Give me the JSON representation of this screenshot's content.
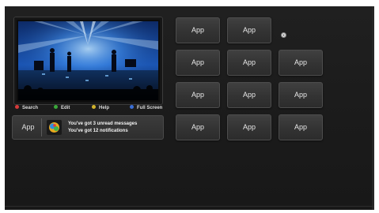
{
  "legend": {
    "items": [
      {
        "label": "Search",
        "color": "#d63a3a"
      },
      {
        "label": "Edit",
        "color": "#3aa83a"
      },
      {
        "label": "Help",
        "color": "#d1b22c"
      },
      {
        "label": "Full Screen",
        "color": "#3a6ed6"
      }
    ]
  },
  "notification": {
    "app_label": "App",
    "line1": "You've got 3 unread messages",
    "line2": "You've got 12 notifications"
  },
  "apps": [
    {
      "label": "App"
    },
    {
      "label": "App"
    },
    {
      "label": "App"
    },
    {
      "label": "App"
    },
    {
      "label": "App"
    },
    {
      "label": "App"
    },
    {
      "label": "App"
    },
    {
      "label": "App"
    },
    {
      "label": "App"
    },
    {
      "label": "App"
    },
    {
      "label": "App"
    }
  ],
  "colors": {
    "background": "#1e1e1e",
    "tile": "#383838",
    "stage_blue": "#2e7bd8"
  }
}
